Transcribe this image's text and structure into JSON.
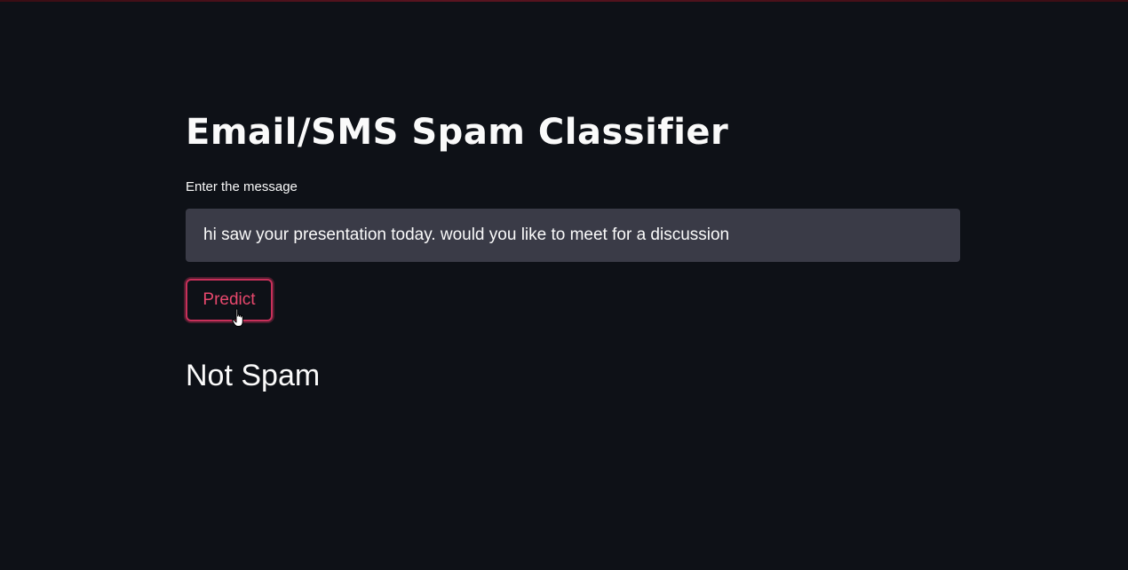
{
  "app": {
    "title": "Email/SMS Spam Classifier"
  },
  "form": {
    "input_label": "Enter the message",
    "input_value": "hi saw your presentation today. would you like to meet for a discussion",
    "submit_label": "Predict"
  },
  "result": {
    "text": "Not Spam"
  },
  "icons": {
    "cursor": "hand-pointer-icon"
  },
  "colors": {
    "background": "#0e1117",
    "input_background": "#3a3b47",
    "accent": "#e8486d",
    "text": "#fafafa"
  }
}
